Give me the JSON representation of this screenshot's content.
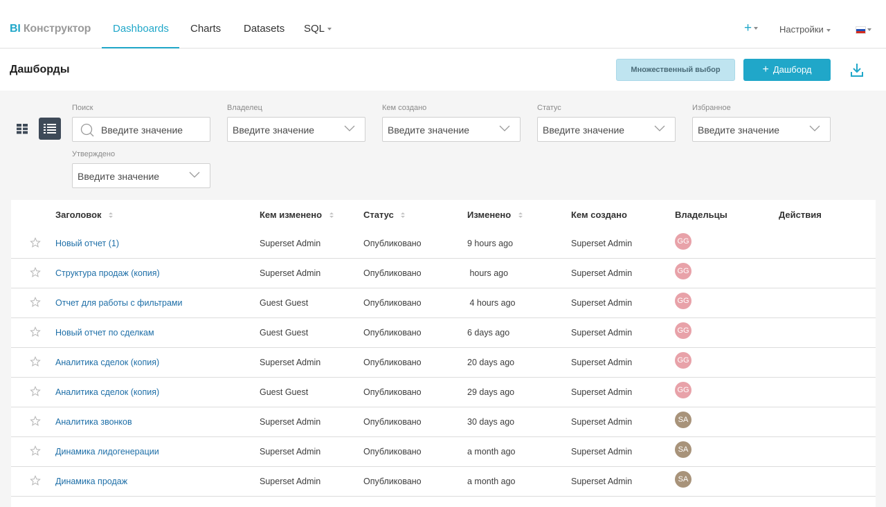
{
  "brand": {
    "bi": "BI",
    "name": "Конструктор"
  },
  "nav": {
    "tabs": [
      "Dashboards",
      "Charts",
      "Datasets",
      "SQL"
    ],
    "active": "Dashboards",
    "settings_label": "Настройки",
    "plus_label": "+"
  },
  "header": {
    "title": "Дашборды",
    "multi_select_label": "Множественный выбор",
    "add_dashboard_label": "Дашборд",
    "add_icon": "plus-icon"
  },
  "filters": {
    "search": {
      "label": "Поиск",
      "placeholder": "Введите значение"
    },
    "owner": {
      "label": "Владелец",
      "placeholder": "Введите значение"
    },
    "created_by": {
      "label": "Кем создано",
      "placeholder": "Введите значение"
    },
    "status": {
      "label": "Статус",
      "placeholder": "Введите значение"
    },
    "favorite": {
      "label": "Избранное",
      "placeholder": "Введите значение"
    },
    "approved": {
      "label": "Утверждено",
      "placeholder": "Введите значение"
    }
  },
  "table": {
    "columns": [
      "Заголовок",
      "Кем изменено",
      "Статус",
      "Изменено",
      "Кем создано",
      "Владельцы",
      "Действия"
    ],
    "rows": [
      {
        "title": "Новый отчет (1)",
        "modified_by": "Superset Admin",
        "status": "Опубликовано",
        "modified": "9 hours ago",
        "created_by": "Superset Admin",
        "owner": "GG"
      },
      {
        "title": "Структура продаж (копия)",
        "modified_by": "Superset Admin",
        "status": "Опубликовано",
        "modified": " hours ago",
        "created_by": "Superset Admin",
        "owner": "GG"
      },
      {
        "title": "Отчет для работы с фильтрами",
        "modified_by": "Guest Guest",
        "status": "Опубликовано",
        "modified": " 4 hours ago",
        "created_by": "Superset Admin",
        "owner": "GG"
      },
      {
        "title": "Новый отчет по сделкам",
        "modified_by": "Guest Guest",
        "status": "Опубликовано",
        "modified": "6 days ago",
        "created_by": "Superset Admin",
        "owner": "GG"
      },
      {
        "title": "Аналитика сделок (копия)",
        "modified_by": "Superset Admin",
        "status": "Опубликовано",
        "modified": "20 days ago",
        "created_by": "Superset Admin",
        "owner": "GG"
      },
      {
        "title": "Аналитика сделок (копия)",
        "modified_by": "Guest Guest",
        "status": "Опубликовано",
        "modified": "29 days ago",
        "created_by": "Superset Admin",
        "owner": "GG"
      },
      {
        "title": "Аналитика звонков",
        "modified_by": "Superset Admin",
        "status": "Опубликовано",
        "modified": "30 days ago",
        "created_by": "Superset Admin",
        "owner": "SA"
      },
      {
        "title": "Динамика лидогенерации",
        "modified_by": "Superset Admin",
        "status": "Опубликовано",
        "modified": "a month ago",
        "created_by": "Superset Admin",
        "owner": "SA"
      },
      {
        "title": "Динамика продаж",
        "modified_by": "Superset Admin",
        "status": "Опубликовано",
        "modified": "a month ago",
        "created_by": "Superset Admin",
        "owner": "SA"
      }
    ]
  },
  "colors": {
    "accent": "#20a7c9",
    "avatar_gg": "#e8a2a9",
    "avatar_sa": "#a8937a",
    "link": "#1d6ea7"
  }
}
